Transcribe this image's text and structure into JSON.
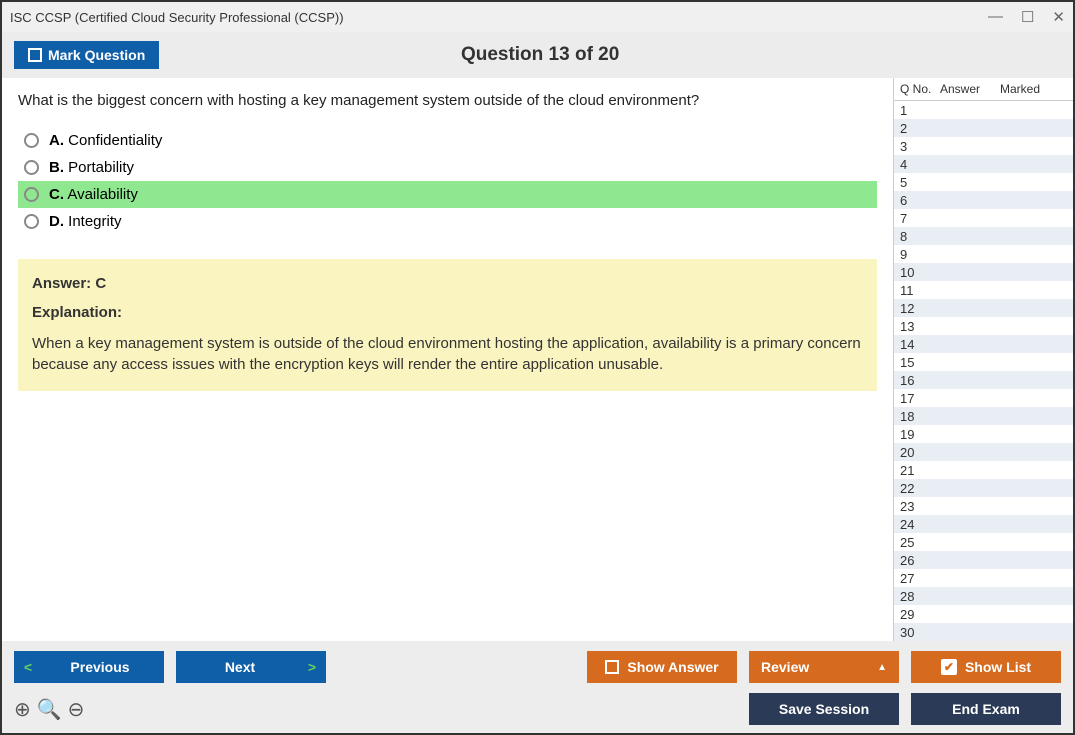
{
  "window": {
    "title": "ISC CCSP (Certified Cloud Security Professional (CCSP))"
  },
  "header": {
    "mark_label": "Mark Question",
    "question_title": "Question 13 of 20"
  },
  "question": {
    "text": "What is the biggest concern with hosting a key management system outside of the cloud environment?",
    "choices": [
      {
        "letter": "A.",
        "text": "Confidentiality",
        "correct": false
      },
      {
        "letter": "B.",
        "text": "Portability",
        "correct": false
      },
      {
        "letter": "C.",
        "text": "Availability",
        "correct": true
      },
      {
        "letter": "D.",
        "text": "Integrity",
        "correct": false
      }
    ],
    "answer_line": "Answer: C",
    "explanation_label": "Explanation:",
    "explanation_text": "When a key management system is outside of the cloud environment hosting the application, availability is a primary concern because any access issues with the encryption keys will render the entire application unusable."
  },
  "side": {
    "columns": {
      "qno": "Q No.",
      "answer": "Answer",
      "marked": "Marked"
    },
    "rows": [
      {
        "n": "1"
      },
      {
        "n": "2"
      },
      {
        "n": "3"
      },
      {
        "n": "4"
      },
      {
        "n": "5"
      },
      {
        "n": "6"
      },
      {
        "n": "7"
      },
      {
        "n": "8"
      },
      {
        "n": "9"
      },
      {
        "n": "10"
      },
      {
        "n": "11"
      },
      {
        "n": "12"
      },
      {
        "n": "13"
      },
      {
        "n": "14"
      },
      {
        "n": "15"
      },
      {
        "n": "16"
      },
      {
        "n": "17"
      },
      {
        "n": "18"
      },
      {
        "n": "19"
      },
      {
        "n": "20"
      },
      {
        "n": "21"
      },
      {
        "n": "22"
      },
      {
        "n": "23"
      },
      {
        "n": "24"
      },
      {
        "n": "25"
      },
      {
        "n": "26"
      },
      {
        "n": "27"
      },
      {
        "n": "28"
      },
      {
        "n": "29"
      },
      {
        "n": "30"
      }
    ]
  },
  "footer": {
    "previous": "Previous",
    "next": "Next",
    "show_answer": "Show Answer",
    "review": "Review",
    "show_list": "Show List",
    "save_session": "Save Session",
    "end_exam": "End Exam"
  }
}
